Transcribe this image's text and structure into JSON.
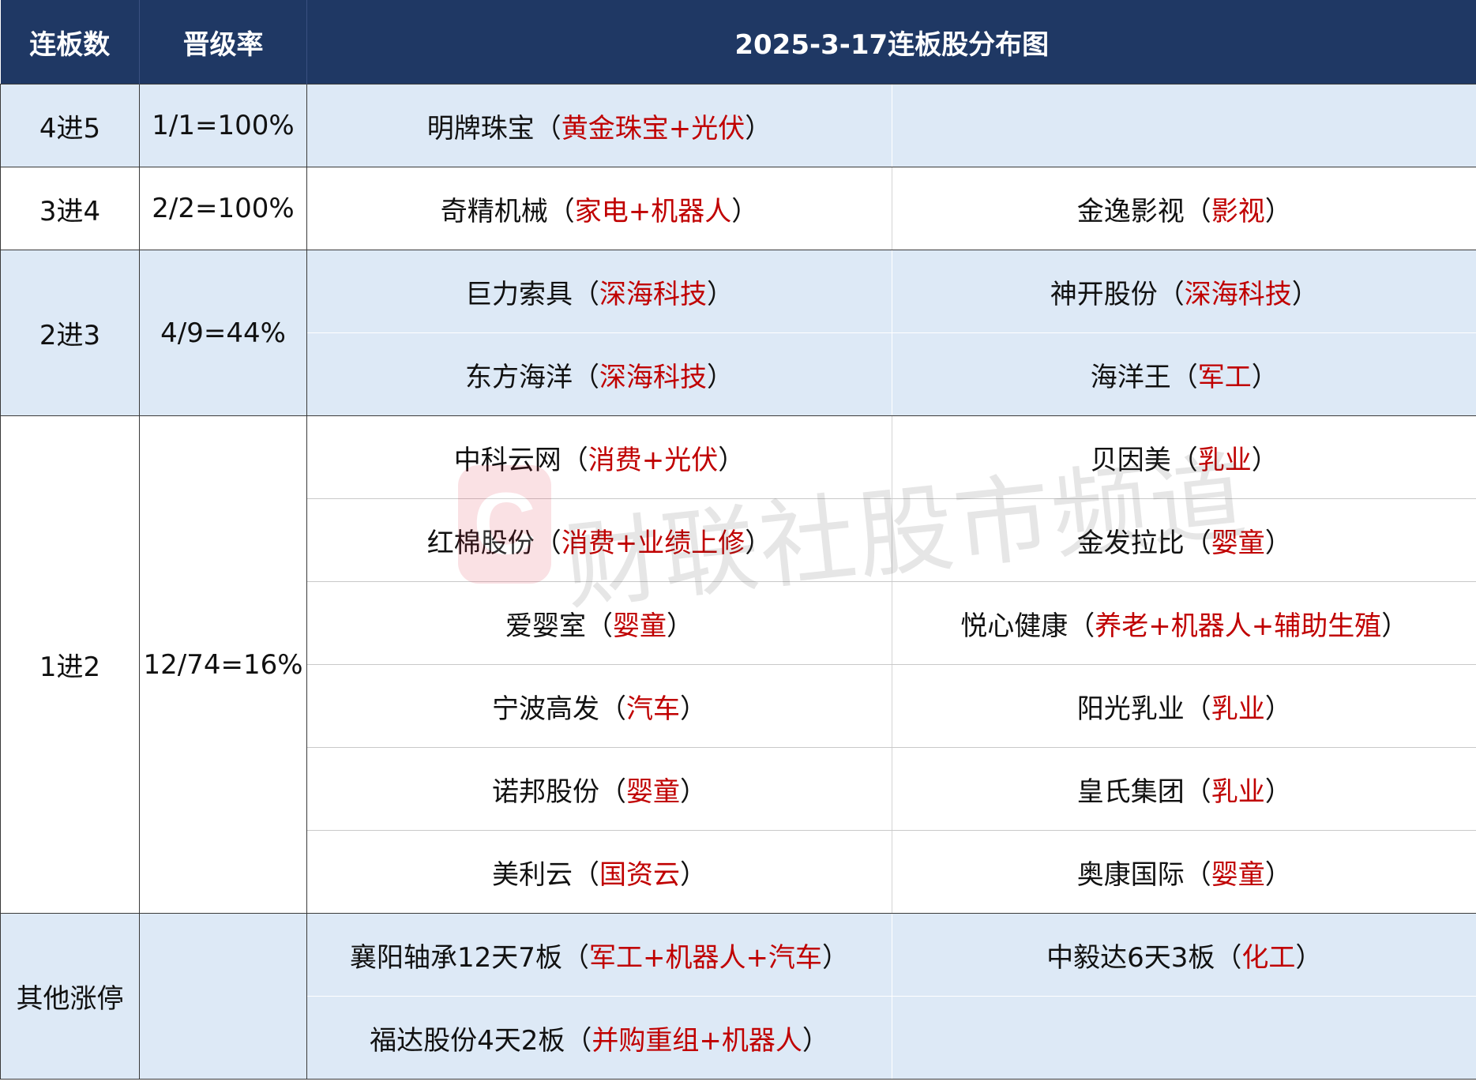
{
  "header": {
    "col_streak": "连板数",
    "col_rate": "晋级率",
    "col_title": "2025-3-17连板股分布图"
  },
  "groups": {
    "g4to5": {
      "label": "4进5",
      "rate": "1/1=100%",
      "stocks": [
        {
          "name": "明牌珠宝",
          "tag": "黄金珠宝+光伏"
        }
      ]
    },
    "g3to4": {
      "label": "3进4",
      "rate": "2/2=100%",
      "stocks": [
        {
          "name": "奇精机械",
          "tag": "家电+机器人"
        },
        {
          "name": "金逸影视",
          "tag": "影视"
        }
      ]
    },
    "g2to3": {
      "label": "2进3",
      "rate": "4/9=44%",
      "stocks": [
        {
          "name": "巨力索具",
          "tag": "深海科技"
        },
        {
          "name": "神开股份",
          "tag": "深海科技"
        },
        {
          "name": "东方海洋",
          "tag": "深海科技"
        },
        {
          "name": "海洋王",
          "tag": "军工"
        }
      ]
    },
    "g1to2": {
      "label": "1进2",
      "rate": "12/74=16%",
      "stocks": [
        {
          "name": "中科云网",
          "tag": "消费+光伏"
        },
        {
          "name": "贝因美",
          "tag": "乳业"
        },
        {
          "name": "红棉股份",
          "tag": "消费+业绩上修"
        },
        {
          "name": "金发拉比",
          "tag": "婴童"
        },
        {
          "name": "爱婴室",
          "tag": "婴童"
        },
        {
          "name": "悦心健康",
          "tag": "养老+机器人+辅助生殖"
        },
        {
          "name": "宁波高发",
          "tag": "汽车"
        },
        {
          "name": "阳光乳业",
          "tag": "乳业"
        },
        {
          "name": "诺邦股份",
          "tag": "婴童"
        },
        {
          "name": "皇氏集团",
          "tag": "乳业"
        },
        {
          "name": "美利云",
          "tag": "国资云"
        },
        {
          "name": "奥康国际",
          "tag": "婴童"
        }
      ]
    },
    "others": {
      "label": "其他涨停",
      "rate": "",
      "stocks": [
        {
          "name": "襄阳轴承12天7板",
          "tag": "军工+机器人+汽车"
        },
        {
          "name": "中毅达6天3板",
          "tag": "化工"
        },
        {
          "name": "福达股份4天2板",
          "tag": "并购重组+机器人"
        }
      ]
    }
  },
  "paren_open": "（",
  "paren_close": "）",
  "watermark": {
    "logo_letter": "C",
    "text": "财联社股市频道",
    "color": "#e0203a"
  },
  "colors": {
    "header_bg": "#1f3864",
    "row_blue": "#dde9f6",
    "tag_red": "#c00000"
  }
}
